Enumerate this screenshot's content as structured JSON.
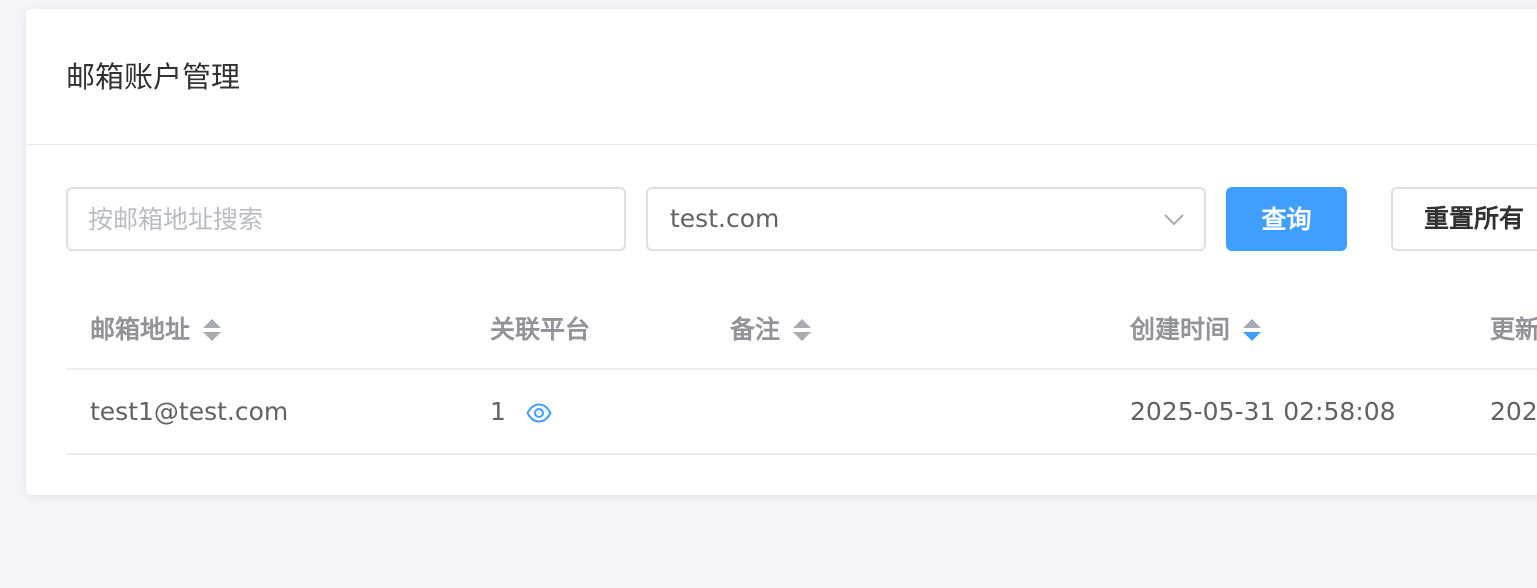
{
  "header": {
    "title": "邮箱账户管理"
  },
  "filters": {
    "search_placeholder": "按邮箱地址搜索",
    "search_value": "",
    "domain_selected": "test.com",
    "query_label": "查询",
    "reset_label": "重置所有"
  },
  "table": {
    "columns": [
      {
        "label": "邮箱地址",
        "sortable": true,
        "sort_state": "none"
      },
      {
        "label": "关联平台",
        "sortable": false
      },
      {
        "label": "备注",
        "sortable": true,
        "sort_state": "none"
      },
      {
        "label": "创建时间",
        "sortable": true,
        "sort_state": "descending"
      },
      {
        "label": "更新",
        "sortable": false
      }
    ],
    "rows": [
      {
        "email": "test1@test.com",
        "platform_count": "1",
        "platform_icon": "eye-icon",
        "note": "",
        "created_at": "2025-05-31 02:58:08",
        "updated_at": "202"
      }
    ]
  },
  "colors": {
    "primary": "#409eff",
    "header_text": "#909399",
    "body_text": "#606266",
    "sort_inactive": "#a8abb2",
    "sort_active": "#409eff"
  }
}
